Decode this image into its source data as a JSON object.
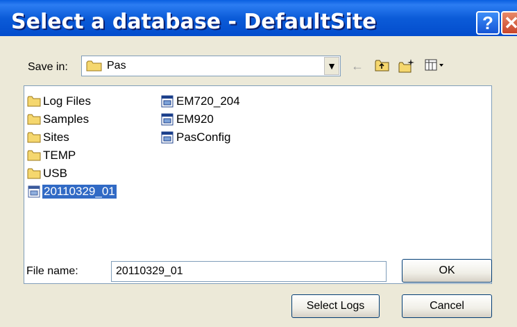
{
  "window": {
    "title": "Select a database - DefaultSite",
    "help_glyph": "?",
    "close_glyph": "✕"
  },
  "toolbar": {
    "save_in_label": "Save in:",
    "save_in_value": "Pas",
    "icons": [
      "back-arrow-icon",
      "up-folder-icon",
      "new-folder-icon",
      "view-menu-icon"
    ]
  },
  "files": {
    "column1": [
      {
        "label": "Log Files",
        "type": "folder",
        "selected": false
      },
      {
        "label": "Samples",
        "type": "folder",
        "selected": false
      },
      {
        "label": "Sites",
        "type": "folder",
        "selected": false
      },
      {
        "label": "TEMP",
        "type": "folder",
        "selected": false
      },
      {
        "label": "USB",
        "type": "folder",
        "selected": false
      },
      {
        "label": "20110329_01",
        "type": "database",
        "selected": true
      }
    ],
    "column2": [
      {
        "label": "EM720_204",
        "type": "database",
        "selected": false
      },
      {
        "label": "EM920",
        "type": "database",
        "selected": false
      },
      {
        "label": "PasConfig",
        "type": "database",
        "selected": false
      }
    ]
  },
  "form": {
    "file_name_label": "File name:",
    "file_name_value": "20110329_01",
    "ok_label": "OK",
    "select_logs_label": "Select Logs",
    "cancel_label": "Cancel"
  },
  "colors": {
    "titlebar": "#0054e3",
    "selection": "#316ac5",
    "dialog_bg": "#ece9d8",
    "folder": "#f5d76e"
  }
}
